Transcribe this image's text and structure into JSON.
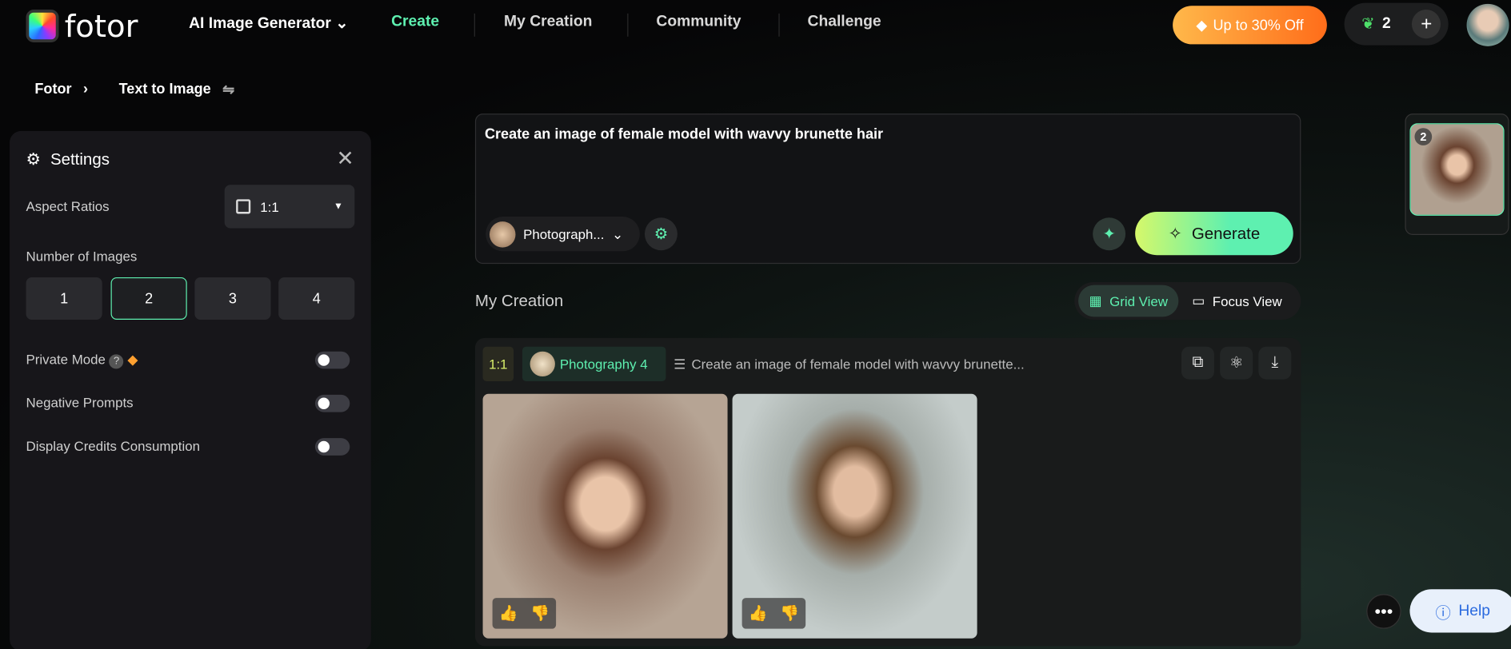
{
  "header": {
    "logo": "fotor",
    "product": "AI Image Generator",
    "nav": [
      "Create",
      "My Creation",
      "Community",
      "Challenge"
    ],
    "promo": "Up to 30% Off",
    "credits": "2"
  },
  "breadcrumb": {
    "root": "Fotor",
    "current": "Text to Image"
  },
  "settings": {
    "title": "Settings",
    "aspect_label": "Aspect Ratios",
    "aspect_value": "1:1",
    "num_label": "Number of Images",
    "numbers": [
      "1",
      "2",
      "3",
      "4"
    ],
    "selected": "2",
    "private": "Private Mode",
    "negative": "Negative Prompts",
    "display_credits": "Display Credits Consumption",
    "toggles": {
      "private": false,
      "negative": false,
      "display_credits": false
    }
  },
  "prompt": {
    "text": "Create an image of female model with wavvy brunette hair",
    "style": "Photograph...",
    "generate": "Generate"
  },
  "creation": {
    "title": "My Creation",
    "grid_view": "Grid View",
    "focus_view": "Focus View",
    "ratio": "1:1",
    "style": "Photography 4",
    "prompt": "Create an image of female model with wavvy brunette..."
  },
  "history": {
    "count": "2"
  },
  "help": "Help",
  "colors": {
    "accent": "#5ef0b0",
    "promo": "#ff7a1f"
  }
}
